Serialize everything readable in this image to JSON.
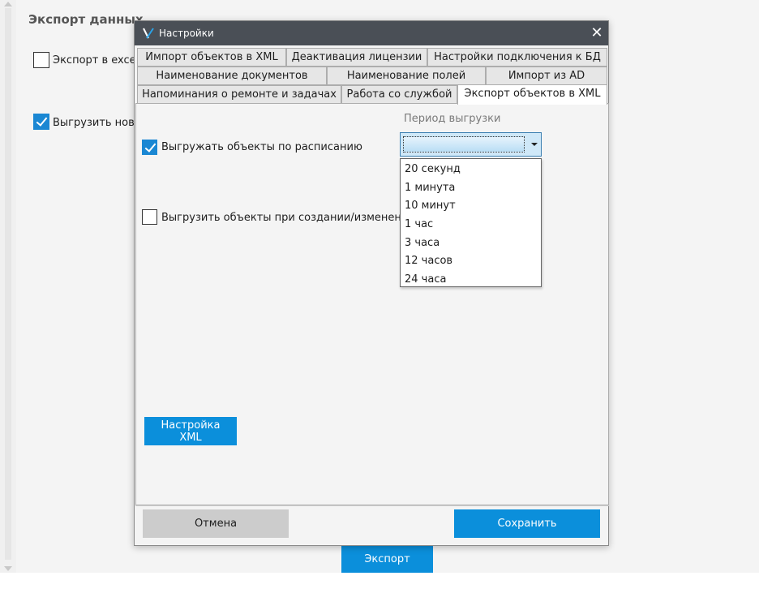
{
  "background": {
    "section_title": "Экспорт данных",
    "export_excel_label": "Экспорт в excel",
    "export_excel_checked": false,
    "upload_new_label": "Выгрузить новы",
    "upload_new_checked": true,
    "export_button": "Экспорт"
  },
  "dialog": {
    "title": "Настройки",
    "close_glyph": "✕",
    "tabs_row1": [
      "Импорт объектов в XML",
      "Деактивация лицензии",
      "Настройки подключения к БД"
    ],
    "tabs_row2": [
      "Наименование документов",
      "Наименование полей",
      "Импорт из AD"
    ],
    "tabs_row3": [
      "Напоминания о ремонте и задачах",
      "Работа со службой",
      "Экспорт объектов в XML"
    ],
    "active_tab": "Экспорт объектов в XML",
    "schedule_label": "Выгружать объекты по расписанию",
    "schedule_checked": true,
    "on_create_label": "Выгрузить объекты при создании/изменении",
    "on_create_checked": false,
    "period_label": "Период выгрузки",
    "period_value": "",
    "period_options": [
      "20 секунд",
      "1 минута",
      "10 минут",
      "1 час",
      "3 часа",
      "12 часов",
      "24 часа"
    ],
    "xml_settings_button": "Настройка XML",
    "cancel_button": "Отмена",
    "save_button": "Сохранить"
  },
  "colors": {
    "accent": "#0b8fdb",
    "titlebar": "#4a4f56",
    "cancel": "#cccccc"
  },
  "icons": {
    "app": "app-logo-icon",
    "close": "close-icon",
    "dropdown": "chevron-down-icon",
    "check": "checkmark-icon"
  }
}
